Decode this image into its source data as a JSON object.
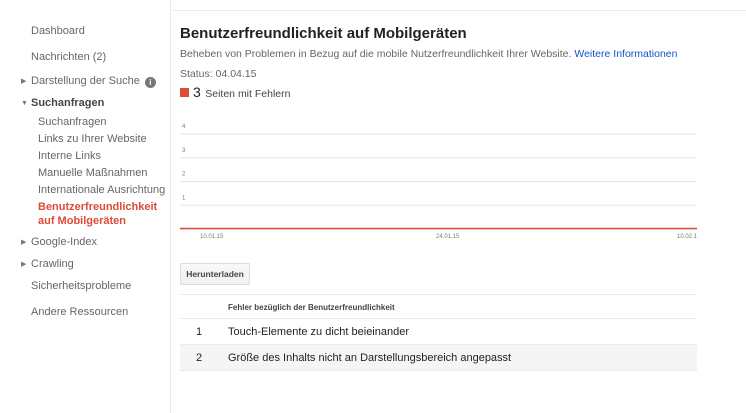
{
  "sidebar": {
    "dashboard": "Dashboard",
    "messages": "Nachrichten (2)",
    "search_appearance": "Darstellung der Suche",
    "search_traffic": "Suchanfragen",
    "sub_items": [
      "Suchanfragen",
      "Links zu Ihrer Website",
      "Interne Links",
      "Manuelle Maßnahmen",
      "Internationale Ausrichtung"
    ],
    "active_line1": "Benutzerfreundlichkeit",
    "active_line2": "auf Mobilgeräten",
    "google_index": "Google-Index",
    "crawling": "Crawling",
    "security": "Sicherheitsprobleme",
    "other": "Andere Ressourcen",
    "info_icon_glyph": "i"
  },
  "main": {
    "title": "Benutzerfreundlichkeit auf Mobilgeräten",
    "description": "Beheben von Problemen in Bezug auf die mobile Nutzerfreundlichkeit Ihrer Website.",
    "more_info_link": "Weitere Informationen",
    "status": "Status: 04.04.15",
    "error_count": "3",
    "error_label": "Seiten mit Fehlern",
    "download_button": "Herunterladen"
  },
  "colors": {
    "error_red": "#dd4b39",
    "link_blue": "#1155cc",
    "grid": "#e5e5e5"
  },
  "chart_data": {
    "type": "line",
    "title": "",
    "xlabel": "",
    "ylabel": "",
    "y_ticks": [
      "1",
      "2",
      "3",
      "4"
    ],
    "ylim": [
      0,
      4
    ],
    "x_tick_labels": [
      "10.01.15",
      "24.01.15",
      "10.02.1"
    ],
    "series": [
      {
        "values": [
          0,
          0,
          0
        ]
      }
    ],
    "grid": true,
    "legend": "none"
  },
  "table": {
    "header": "Fehler bezüglich der Benutzerfreundlichkeit",
    "rows": [
      {
        "index": "1",
        "text": "Touch-Elemente zu dicht beieinander"
      },
      {
        "index": "2",
        "text": "Größe des Inhalts nicht an Darstellungsbereich angepasst"
      }
    ]
  }
}
